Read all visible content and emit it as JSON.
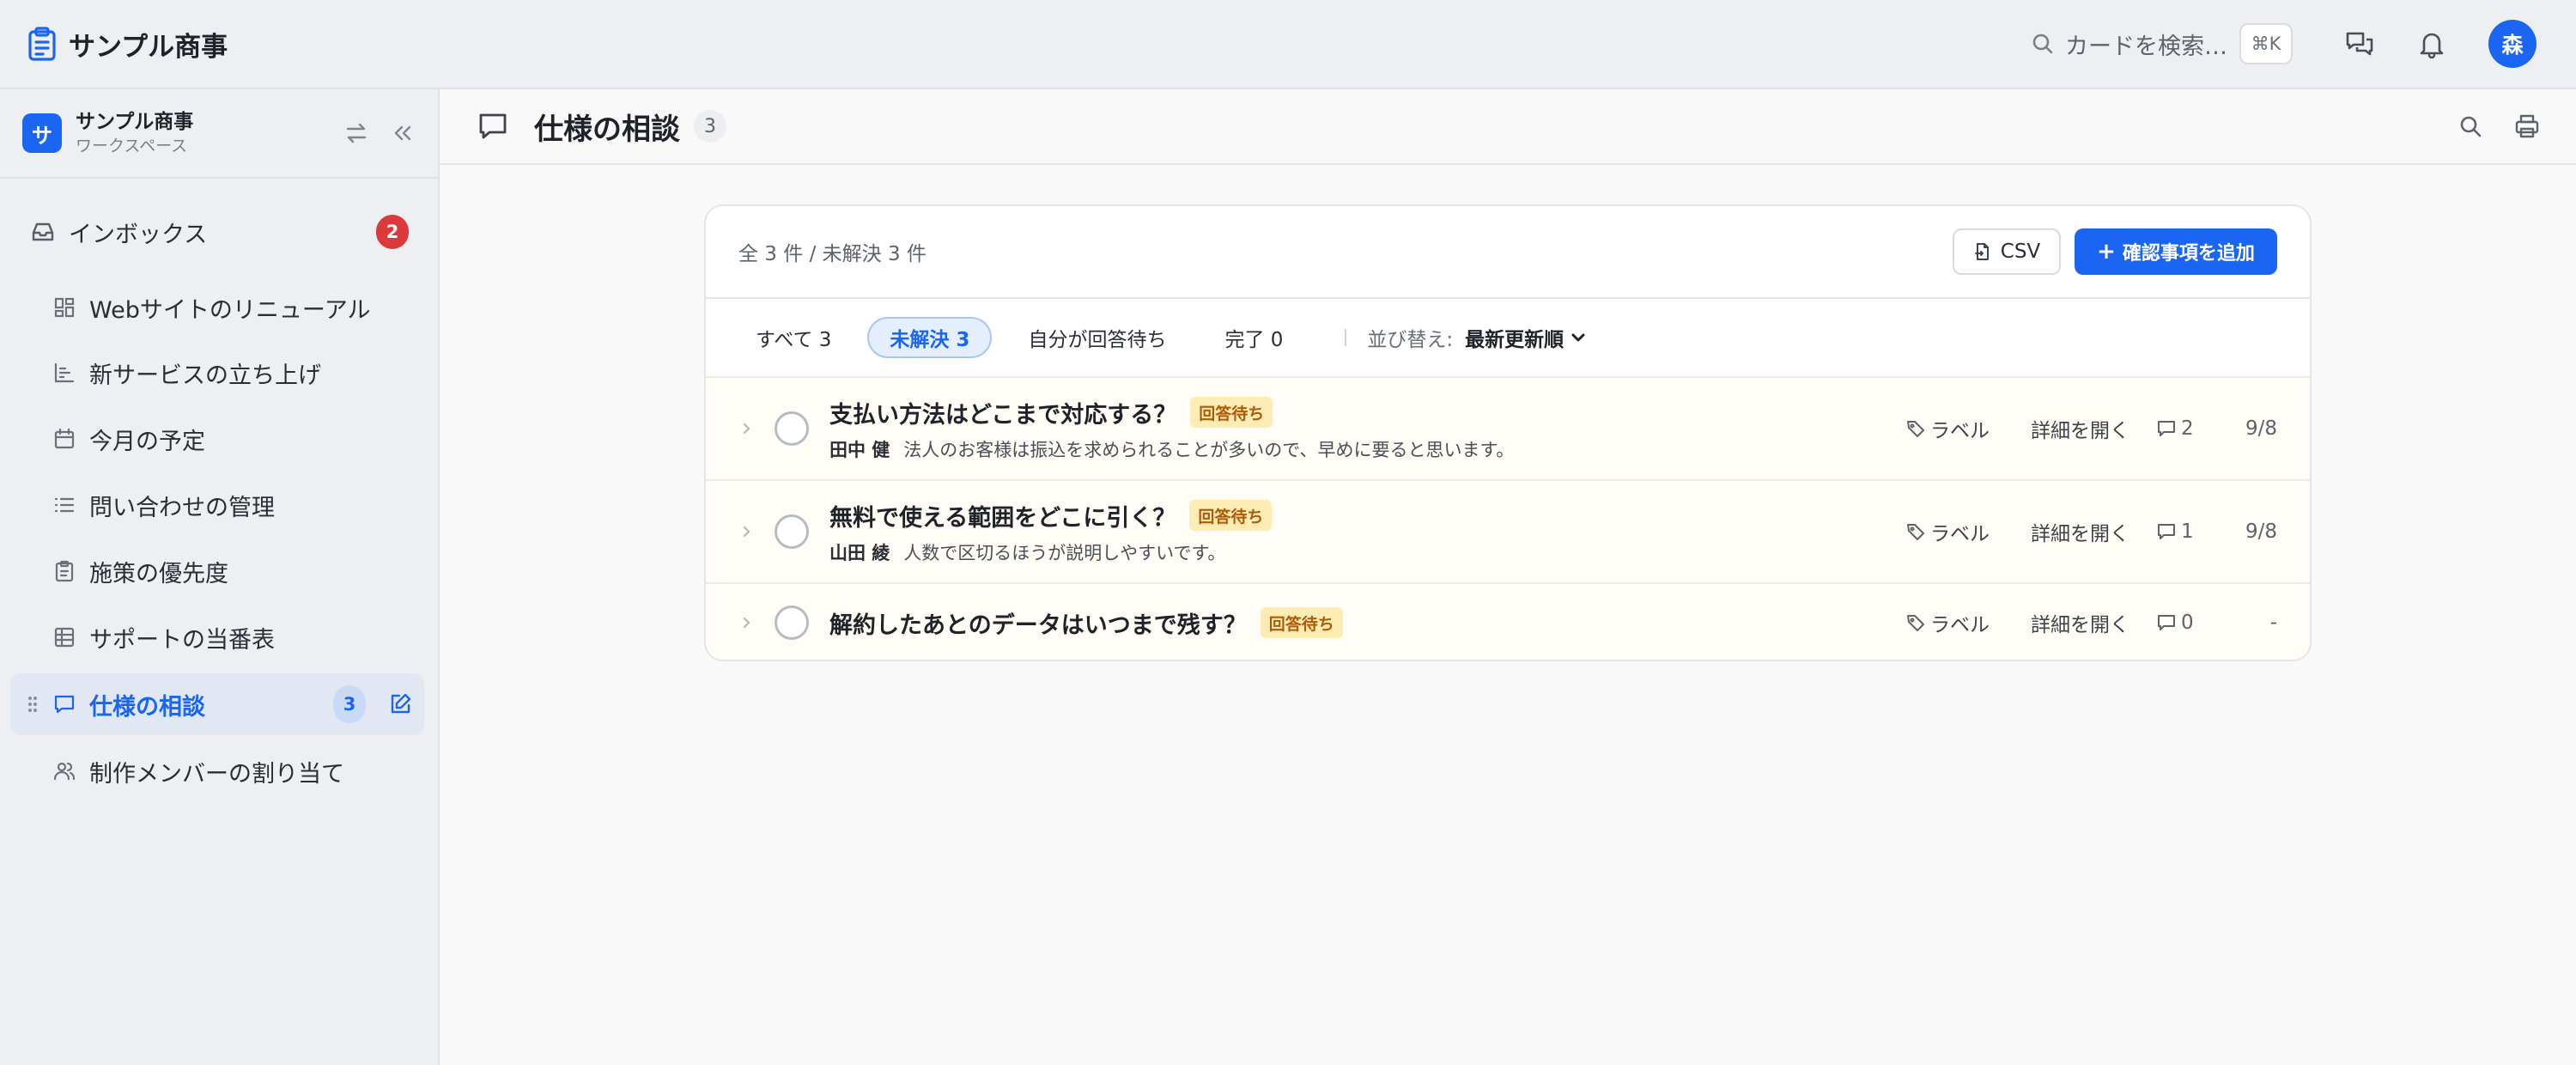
{
  "app": {
    "name": "サンプル商事"
  },
  "topbar": {
    "search_placeholder": "カードを検索…",
    "search_shortcut": "⌘K",
    "avatar_initial": "森",
    "icons": [
      "clipboard-icon",
      "search-icon",
      "chat-icon",
      "bell-icon"
    ]
  },
  "workspace": {
    "name": "サンプル商事",
    "subtitle": "ワークスペース",
    "logo_letter": "サ"
  },
  "sidebar": {
    "inbox": {
      "label": "インボックス",
      "count": "2"
    },
    "items": [
      {
        "label": "Webサイトのリニューアル",
        "icon": "dashboard-icon"
      },
      {
        "label": "新サービスの立ち上げ",
        "icon": "chart-icon"
      },
      {
        "label": "今月の予定",
        "icon": "calendar-icon"
      },
      {
        "label": "問い合わせの管理",
        "icon": "list-icon"
      },
      {
        "label": "施策の優先度",
        "icon": "clipboard-icon"
      },
      {
        "label": "サポートの当番表",
        "icon": "table-icon"
      },
      {
        "label": "仕様の相談",
        "icon": "chat-icon",
        "count": "3",
        "active": true
      },
      {
        "label": "制作メンバーの割り当て",
        "icon": "users-icon"
      }
    ]
  },
  "main": {
    "title": "仕様の相談",
    "count": "3",
    "summary": "全 3 件 / 未解決 3 件",
    "csv_label": "CSV",
    "add_label": "確認事項を追加",
    "filters": [
      {
        "label": "すべて 3",
        "active": false
      },
      {
        "label": "未解決 3",
        "active": true
      },
      {
        "label": "自分が回答待ち",
        "active": false
      },
      {
        "label": "完了 0",
        "active": false
      }
    ],
    "sort_label": "並び替え:",
    "sort_value": "最新更新順",
    "rows": [
      {
        "title": "支払い方法はどこまで対応する？",
        "status": "回答待ち",
        "author": "田中 健",
        "excerpt": "法人のお客様は振込を求められることが多いので、早めに要ると思います。",
        "label_btn": "ラベル",
        "open_btn": "詳細を開く",
        "comments": "2",
        "date": "9/8"
      },
      {
        "title": "無料で使える範囲をどこに引く？",
        "status": "回答待ち",
        "author": "山田 綾",
        "excerpt": "人数で区切るほうが説明しやすいです。",
        "label_btn": "ラベル",
        "open_btn": "詳細を開く",
        "comments": "1",
        "date": "9/8"
      },
      {
        "title": "解約したあとのデータはいつまで残す？",
        "status": "回答待ち",
        "label_btn": "ラベル",
        "open_btn": "詳細を開く",
        "comments": "0",
        "date": "-"
      }
    ]
  },
  "colors": {
    "accent": "#1a66f2",
    "danger": "#dc3a3a",
    "status_bg": "#fdecb4",
    "status_text": "#b05a06"
  }
}
